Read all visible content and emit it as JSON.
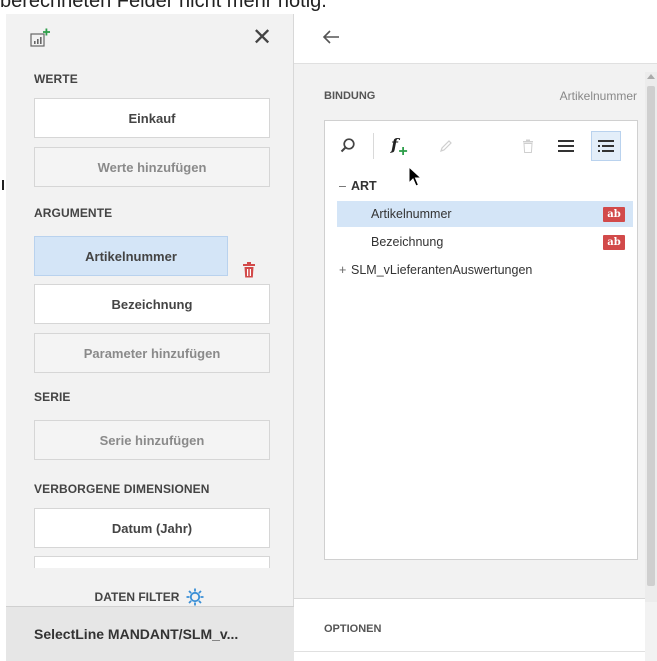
{
  "caption": "berechneten Felder nicht mehr nötig.",
  "left_panel": {
    "sections": [
      {
        "title": "WERTE"
      },
      {
        "title": "ARGUMENTE"
      },
      {
        "title": "SERIE"
      },
      {
        "title": "VERBORGENE DIMENSIONEN"
      }
    ],
    "werte": {
      "item": "Einkauf",
      "add": "Werte hinzufügen"
    },
    "argumente": {
      "item_selected": "Artikelnummer",
      "item": "Bezeichnung",
      "add": "Parameter hinzufügen"
    },
    "serie": {
      "add": "Serie hinzufügen"
    },
    "verborgene": {
      "item": "Datum (Jahr)"
    },
    "filter_label": "DATEN FILTER",
    "source": "SelectLine MANDANT/SLM_v..."
  },
  "right_panel": {
    "bindung_label": "BINDUNG",
    "bindung_value": "Artikelnummer",
    "tree": {
      "root": "ART",
      "root_toggle": "–",
      "children": [
        {
          "label": "Artikelnummer",
          "badge": "ab",
          "selected": true
        },
        {
          "label": "Bezeichnung",
          "badge": "ab",
          "selected": false
        }
      ],
      "root2": "SLM_vLieferantenAuswertungen",
      "root2_toggle": "+"
    },
    "optionen_label": "OPTIONEN"
  },
  "colors": {
    "selected_bg": "#d4e5f7",
    "badge_red": "#d24a4a",
    "gear_blue": "#3a8fd6",
    "plus_green": "#2e9e4a"
  }
}
